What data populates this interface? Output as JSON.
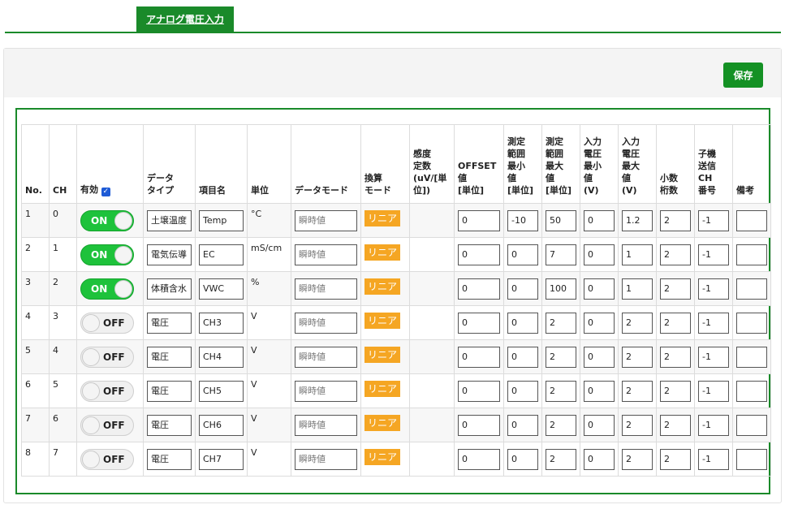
{
  "tabs": {
    "active": "アナログ電圧入力"
  },
  "toolbar": {
    "save_label": "保存"
  },
  "columns": {
    "no": "No.",
    "ch": "CH",
    "enabled": "有効",
    "data_type": "データ\nタイプ",
    "item_name": "項目名",
    "unit": "単位",
    "data_mode": "データモード",
    "conversion_mode": "換算\nモード",
    "sensitivity": "感度\n定数\n(uV/[単\n位])",
    "offset": "OFFSET\n値\n[単位]",
    "range_min": "測定\n範囲\n最小\n値\n[単位]",
    "range_max": "測定\n範囲\n最大\n値\n[単位]",
    "input_min": "入力\n電圧\n最小\n値\n(V)",
    "input_max": "入力\n電圧\n最大\n値\n(V)",
    "decimals": "小数\n桁数",
    "child_ch": "子機\n送信\nCH\n番号",
    "note": "備考"
  },
  "enabled_all_checked": true,
  "rows": [
    {
      "no": "1",
      "ch": "0",
      "toggle": "ON",
      "data_type": "土壌温度",
      "item_name": "Temp",
      "unit": "°C",
      "data_mode": "瞬時値",
      "conversion_mode": "リニア",
      "offset": "0",
      "range_min": "-10",
      "range_max": "50",
      "input_min": "0",
      "input_max": "1.2",
      "decimals": "2",
      "child_ch": "-1",
      "note": ""
    },
    {
      "no": "2",
      "ch": "1",
      "toggle": "ON",
      "data_type": "電気伝導",
      "item_name": "EC",
      "unit": "mS/cm",
      "data_mode": "瞬時値",
      "conversion_mode": "リニア",
      "offset": "0",
      "range_min": "0",
      "range_max": "7",
      "input_min": "0",
      "input_max": "1",
      "decimals": "2",
      "child_ch": "-1",
      "note": ""
    },
    {
      "no": "3",
      "ch": "2",
      "toggle": "ON",
      "data_type": "体積含水",
      "item_name": "VWC",
      "unit": "%",
      "data_mode": "瞬時値",
      "conversion_mode": "リニア",
      "offset": "0",
      "range_min": "0",
      "range_max": "100",
      "input_min": "0",
      "input_max": "1",
      "decimals": "2",
      "child_ch": "-1",
      "note": ""
    },
    {
      "no": "4",
      "ch": "3",
      "toggle": "OFF",
      "data_type": "電圧",
      "item_name": "CH3",
      "unit": "V",
      "data_mode": "瞬時値",
      "conversion_mode": "リニア",
      "offset": "0",
      "range_min": "0",
      "range_max": "2",
      "input_min": "0",
      "input_max": "2",
      "decimals": "2",
      "child_ch": "-1",
      "note": ""
    },
    {
      "no": "5",
      "ch": "4",
      "toggle": "OFF",
      "data_type": "電圧",
      "item_name": "CH4",
      "unit": "V",
      "data_mode": "瞬時値",
      "conversion_mode": "リニア",
      "offset": "0",
      "range_min": "0",
      "range_max": "2",
      "input_min": "0",
      "input_max": "2",
      "decimals": "2",
      "child_ch": "-1",
      "note": ""
    },
    {
      "no": "6",
      "ch": "5",
      "toggle": "OFF",
      "data_type": "電圧",
      "item_name": "CH5",
      "unit": "V",
      "data_mode": "瞬時値",
      "conversion_mode": "リニア",
      "offset": "0",
      "range_min": "0",
      "range_max": "2",
      "input_min": "0",
      "input_max": "2",
      "decimals": "2",
      "child_ch": "-1",
      "note": ""
    },
    {
      "no": "7",
      "ch": "6",
      "toggle": "OFF",
      "data_type": "電圧",
      "item_name": "CH6",
      "unit": "V",
      "data_mode": "瞬時値",
      "conversion_mode": "リニア",
      "offset": "0",
      "range_min": "0",
      "range_max": "2",
      "input_min": "0",
      "input_max": "2",
      "decimals": "2",
      "child_ch": "-1",
      "note": ""
    },
    {
      "no": "8",
      "ch": "7",
      "toggle": "OFF",
      "data_type": "電圧",
      "item_name": "CH7",
      "unit": "V",
      "data_mode": "瞬時値",
      "conversion_mode": "リニア",
      "offset": "0",
      "range_min": "0",
      "range_max": "2",
      "input_min": "0",
      "input_max": "2",
      "decimals": "2",
      "child_ch": "-1",
      "note": ""
    }
  ],
  "colors": {
    "accent": "#1a8a2a",
    "toggle_on": "#1ec23b",
    "badge": "#f5a623"
  }
}
